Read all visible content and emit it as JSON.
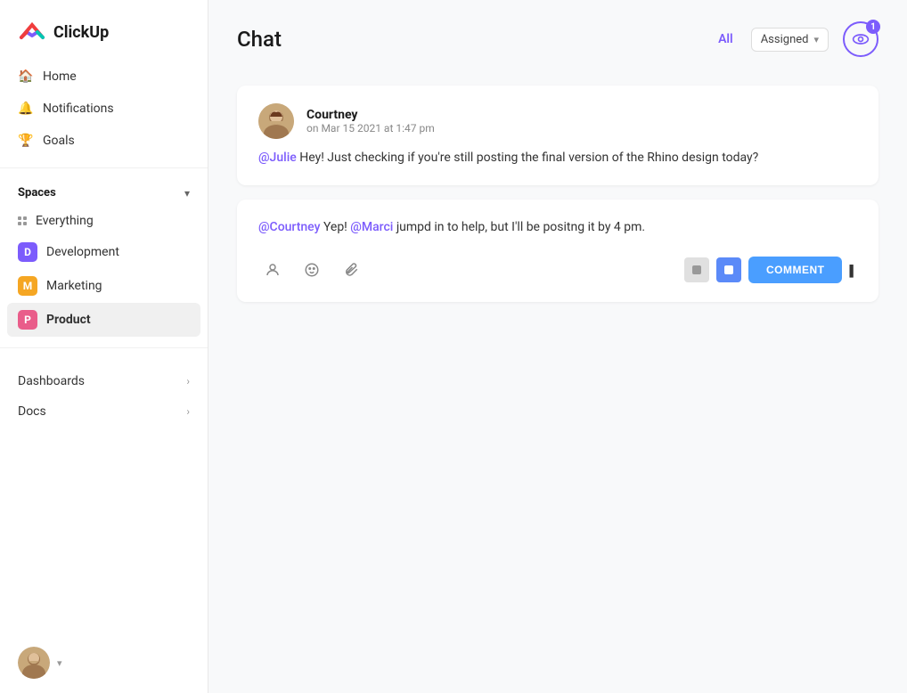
{
  "app": {
    "name": "ClickUp"
  },
  "sidebar": {
    "nav_items": [
      {
        "id": "home",
        "label": "Home",
        "icon": "home-icon"
      },
      {
        "id": "notifications",
        "label": "Notifications",
        "icon": "bell-icon"
      },
      {
        "id": "goals",
        "label": "Goals",
        "icon": "target-icon"
      }
    ],
    "spaces_label": "Spaces",
    "spaces": [
      {
        "id": "everything",
        "label": "Everything",
        "icon": "grid-icon",
        "color": null
      },
      {
        "id": "development",
        "label": "Development",
        "icon": "badge-icon",
        "letter": "D",
        "color": "#7c5cfc"
      },
      {
        "id": "marketing",
        "label": "Marketing",
        "icon": "badge-icon",
        "letter": "M",
        "color": "#f5a623"
      },
      {
        "id": "product",
        "label": "Product",
        "icon": "badge-icon",
        "letter": "P",
        "color": "#e95d8a",
        "bold": true
      }
    ],
    "sections": [
      {
        "id": "dashboards",
        "label": "Dashboards",
        "has_arrow": true
      },
      {
        "id": "docs",
        "label": "Docs",
        "has_arrow": true
      }
    ]
  },
  "chat": {
    "title": "Chat",
    "filter_all": "All",
    "filter_assigned": "Assigned",
    "notification_count": "1",
    "messages": [
      {
        "id": "msg1",
        "author": "Courtney",
        "time": "on Mar 15 2021 at 1:47 pm",
        "mention": "@Julie",
        "body": " Hey! Just checking if you're still posting the final version of the Rhino design today?"
      }
    ],
    "reply": {
      "mention1": "@Courtney",
      "text1": " Yep! ",
      "mention2": "@Marci",
      "text2": " jumpd in to help, but I'll be positng it by 4 pm."
    },
    "comment_button": "COMMENT"
  }
}
